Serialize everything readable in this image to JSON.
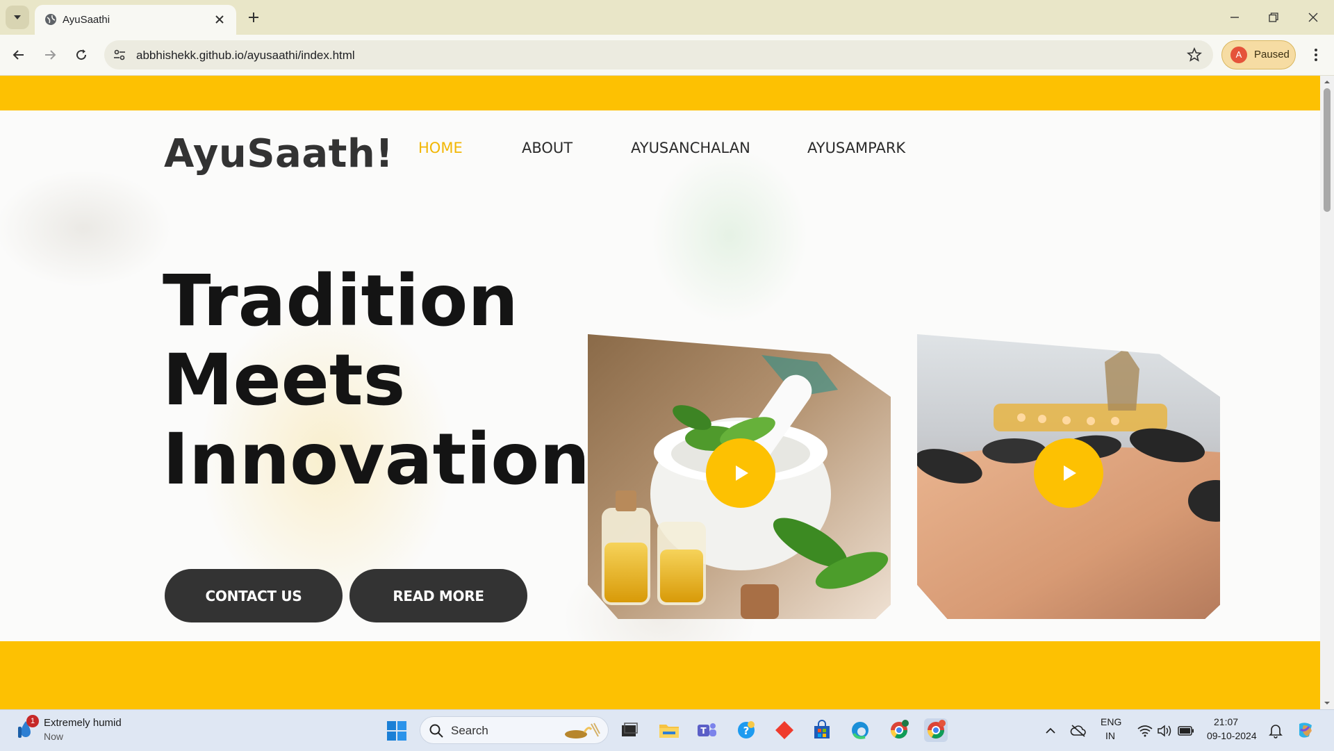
{
  "browser": {
    "tab_title": "AyuSaathi",
    "url": "abbhishekk.github.io/ayusaathi/index.html",
    "profile_initial": "A",
    "profile_status": "Paused"
  },
  "site": {
    "logo": "AyuSaath!",
    "nav": [
      {
        "label": "HOME",
        "active": true
      },
      {
        "label": "ABOUT",
        "active": false
      },
      {
        "label": "AYUSANCHALAN",
        "active": false
      },
      {
        "label": "AYUSAMPARK",
        "active": false
      }
    ],
    "headline": [
      "Tradition",
      "Meets",
      "Innovation"
    ],
    "buttons": {
      "contact": "CONTACT US",
      "read_more": "READ MORE"
    },
    "accent_color": "#fdc102",
    "videos": [
      {
        "name": "herbal-mortar-oils-video",
        "icon": "play-icon"
      },
      {
        "name": "hot-stone-massage-video",
        "icon": "play-icon"
      }
    ]
  },
  "taskbar": {
    "weather_text": "Extremely humid",
    "weather_sub": "Now",
    "weather_badge": "1",
    "search_placeholder": "Search",
    "lang_line1": "ENG",
    "lang_line2": "IN",
    "time": "21:07",
    "date": "09-10-2024"
  }
}
